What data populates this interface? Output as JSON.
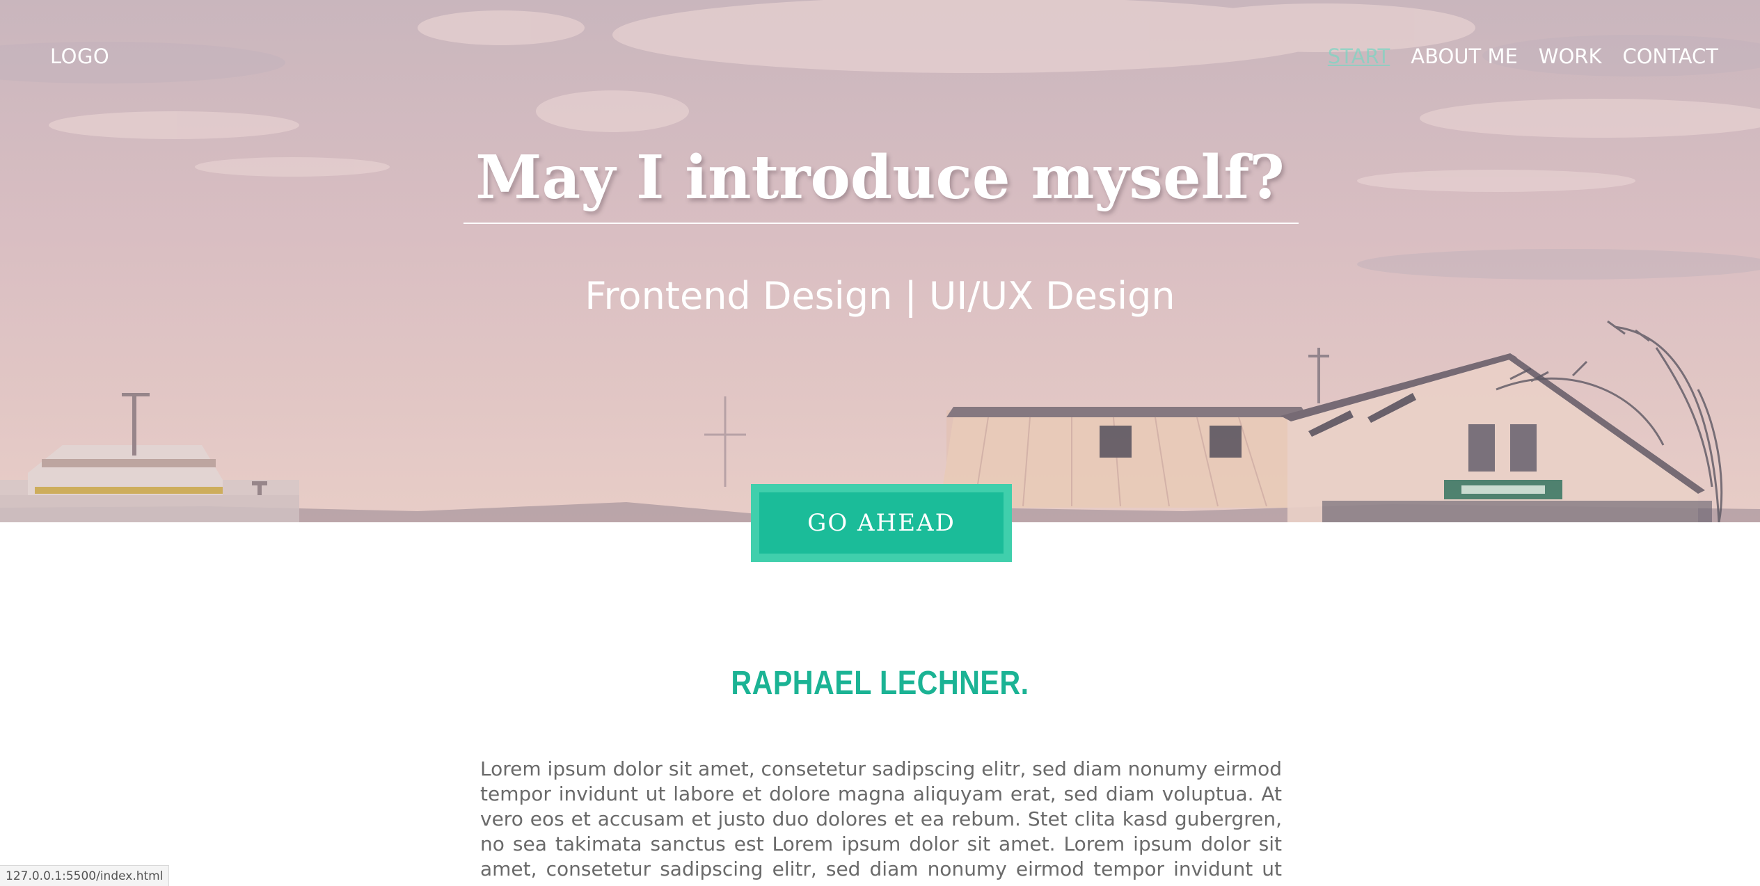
{
  "nav": {
    "logo": "LOGO",
    "items": [
      "START",
      "ABOUT ME",
      "WORK",
      "CONTACT"
    ]
  },
  "hero": {
    "title": "May I introduce myself?",
    "subtitle": "Frontend Design | UI/UX Design",
    "cta_label": "GO AHEAD"
  },
  "about": {
    "name": "RAPHAEL LECHNER.",
    "bio": "Lorem ipsum dolor sit amet, consetetur sadipscing elitr, sed diam nonumy eirmod tempor invidunt ut labore et dolore magna aliquyam erat, sed diam voluptua. At vero eos et accusam et justo duo dolores et ea rebum. Stet clita kasd gubergren, no sea takimata sanctus est Lorem ipsum dolor sit amet. Lorem ipsum dolor sit amet, consetetur sadipscing elitr, sed diam nonumy eirmod tempor invidunt ut labore et"
  },
  "status_bar": {
    "url": "127.0.0.1:5500/index.html"
  },
  "colors": {
    "accent": "#1bbc99",
    "accent_border": "#40cfac",
    "name_text": "#1bb394",
    "body_text": "#6a6a6a",
    "hero_tint": "#d6bcc0"
  }
}
